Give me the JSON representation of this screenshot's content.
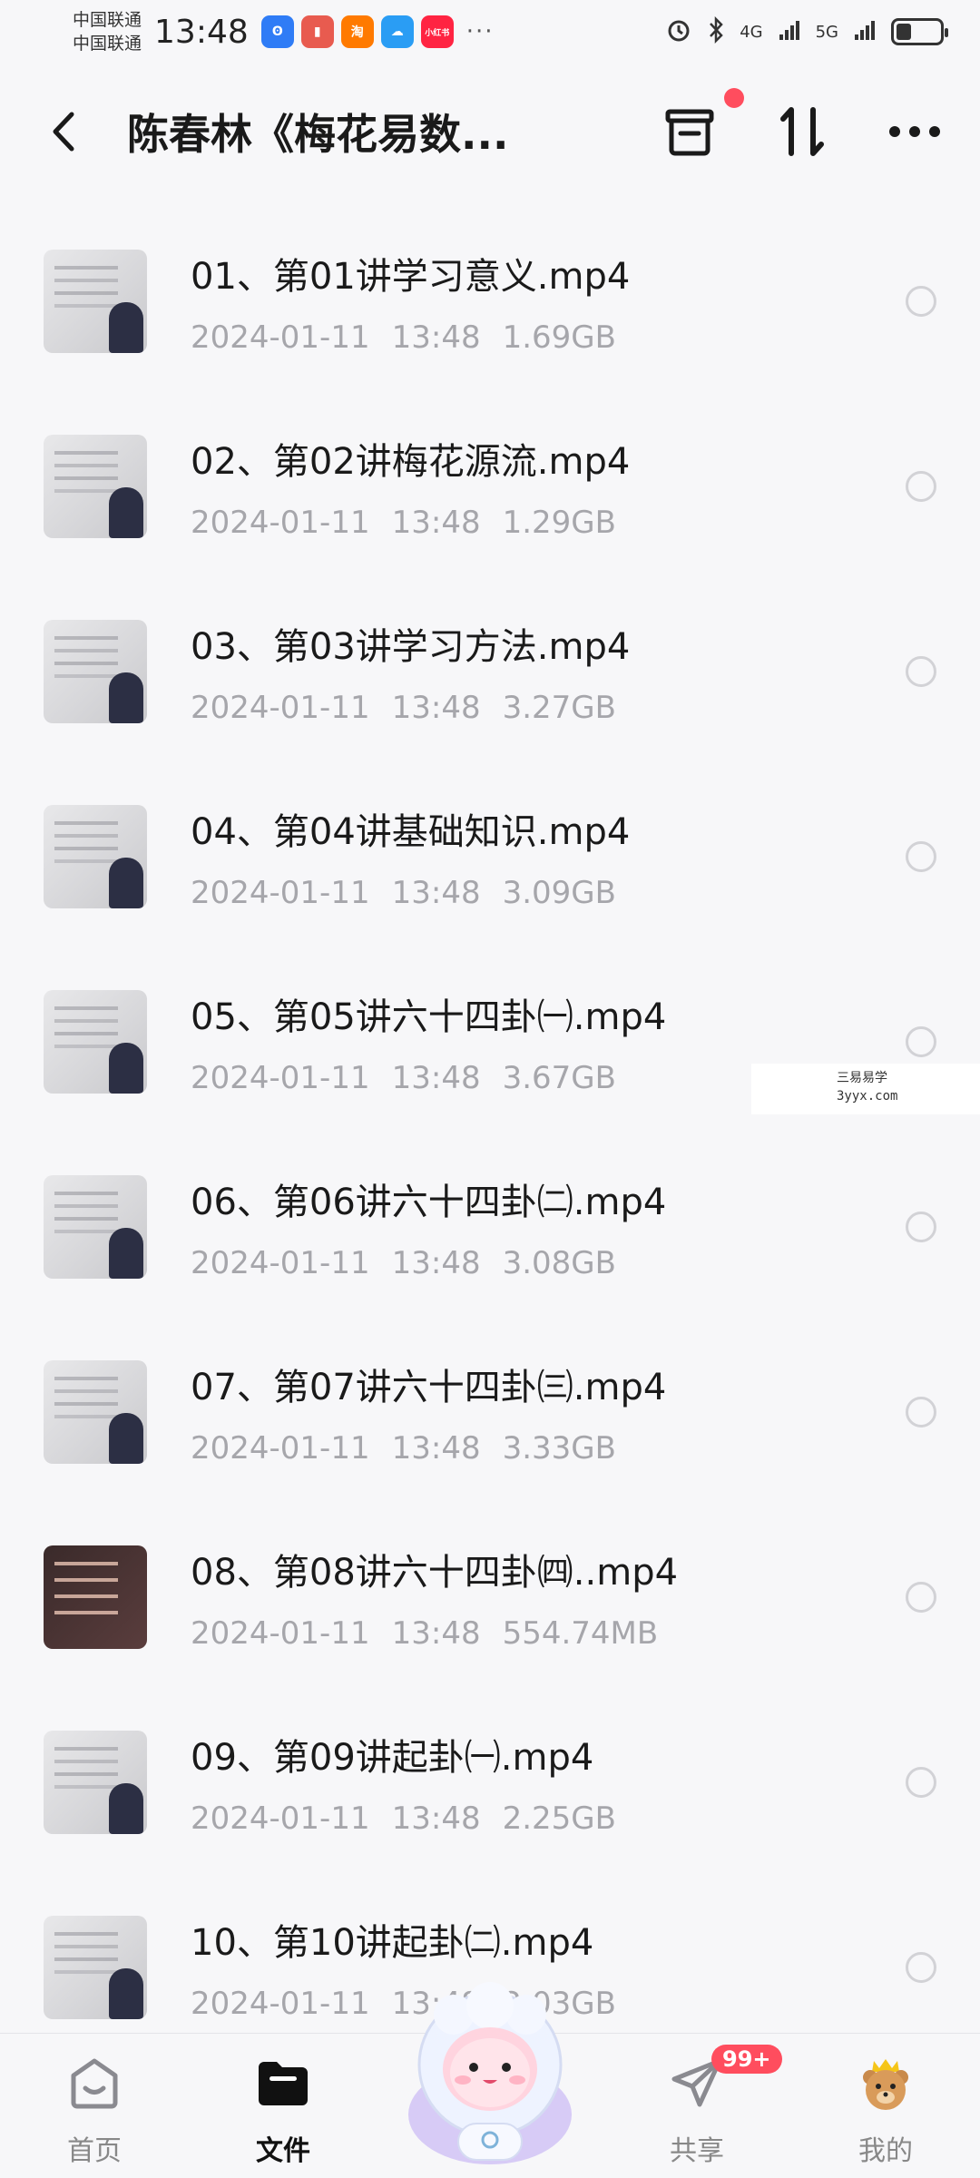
{
  "status_bar": {
    "carrier_1": "中国联通",
    "carrier_2": "中国联通",
    "time": "13:48",
    "app_icons": [
      {
        "name": "app-icon-blue",
        "text": "ʘ",
        "color": "#2f7cf6"
      },
      {
        "name": "app-icon-huawei",
        "text": "▮",
        "color": "#e85b4f"
      },
      {
        "name": "app-icon-taobao",
        "text": "淘",
        "color": "#ff7a00"
      },
      {
        "name": "app-icon-weather",
        "text": "☁",
        "color": "#2a9df4"
      },
      {
        "name": "app-icon-xiaohongshu",
        "text": "小红书",
        "color": "#ff2442"
      }
    ],
    "more": "···",
    "network_4g": "4G",
    "network_5g": "5G",
    "battery_level": 0.34
  },
  "header": {
    "title": "陈春林《梅花易数..."
  },
  "files": [
    {
      "name": "01、第01讲学习意义.mp4",
      "date": "2024-01-11",
      "time": "13:48",
      "size": "1.69GB"
    },
    {
      "name": "02、第02讲梅花源流.mp4",
      "date": "2024-01-11",
      "time": "13:48",
      "size": "1.29GB"
    },
    {
      "name": "03、第03讲学习方法.mp4",
      "date": "2024-01-11",
      "time": "13:48",
      "size": "3.27GB"
    },
    {
      "name": "04、第04讲基础知识.mp4",
      "date": "2024-01-11",
      "time": "13:48",
      "size": "3.09GB"
    },
    {
      "name": "05、第05讲六十四卦㈠.mp4",
      "date": "2024-01-11",
      "time": "13:48",
      "size": "3.67GB"
    },
    {
      "name": "06、第06讲六十四卦㈡.mp4",
      "date": "2024-01-11",
      "time": "13:48",
      "size": "3.08GB"
    },
    {
      "name": "07、第07讲六十四卦㈢.mp4",
      "date": "2024-01-11",
      "time": "13:48",
      "size": "3.33GB"
    },
    {
      "name": "08、第08讲六十四卦㈣..mp4",
      "date": "2024-01-11",
      "time": "13:48",
      "size": "554.74MB"
    },
    {
      "name": "09、第09讲起卦㈠.mp4",
      "date": "2024-01-11",
      "time": "13:48",
      "size": "2.25GB"
    },
    {
      "name": "10、第10讲起卦㈡.mp4",
      "date": "2024-01-11",
      "time": "13:48",
      "size": "2.03GB"
    }
  ],
  "watermark": {
    "line1": "三易易学",
    "line2": "3yyx.com"
  },
  "bottom_nav": {
    "home": "首页",
    "files": "文件",
    "share": "共享",
    "share_badge": "99+",
    "mine": "我的"
  }
}
